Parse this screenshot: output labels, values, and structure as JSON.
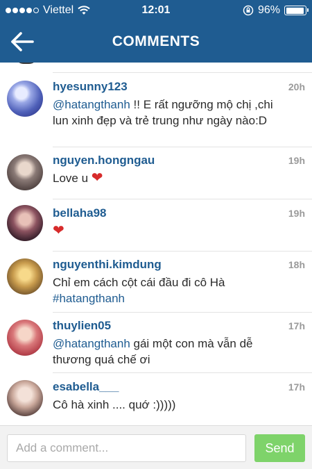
{
  "status_bar": {
    "carrier": "Viettel",
    "time": "12:01",
    "battery_percent": "96%",
    "battery_level": 0.96,
    "icons": [
      "signal-dots",
      "wifi-icon",
      "orientation-lock-icon",
      "battery-icon"
    ]
  },
  "nav": {
    "title": "COMMENTS",
    "back_icon": "arrow-left-icon"
  },
  "colors": {
    "brand": "#1f5c91",
    "send": "#7ed36a",
    "heart": "#d72b2b"
  },
  "comments": [
    {
      "username": "hyesunny123",
      "time": "20h",
      "mention": "@hatangthanh",
      "text": " !! E rất ngưỡng mộ chị ,chi lun xinh đẹp và trẻ trung như ngày nào:D"
    },
    {
      "username": "nguyen.hongngau",
      "time": "19h",
      "text": "Love u ",
      "emoji": "❤"
    },
    {
      "username": "bellaha98",
      "time": "19h",
      "text": "",
      "emoji": "❤"
    },
    {
      "username": "nguyenthi.kimdung",
      "time": "18h",
      "text": "Chỉ em cách cột cái đầu đi cô Hà ",
      "hashtag": "#hatangthanh"
    },
    {
      "username": "thuylien05",
      "time": "17h",
      "mention": "@hatangthanh",
      "text": "  gái một con mà vẫn dễ thương quá chế ơi"
    },
    {
      "username": "esabella___",
      "time": "17h",
      "text": "Cô hà xinh .... quớ :)))))"
    }
  ],
  "composer": {
    "placeholder": "Add a comment...",
    "value": "",
    "send_label": "Send"
  }
}
